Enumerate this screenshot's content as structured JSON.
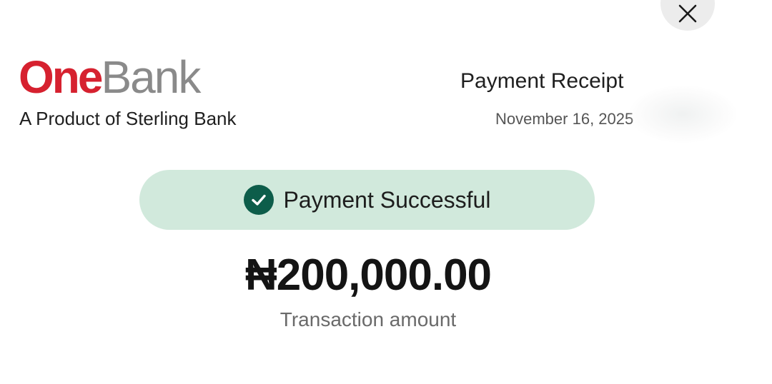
{
  "header": {
    "logo": {
      "part1": "One",
      "part2": "Bank"
    },
    "tagline": "A Product of Sterling Bank",
    "receipt_title": "Payment Receipt",
    "date": "November 16, 2025"
  },
  "status": {
    "label": "Payment Successful",
    "icon": "check-circle-icon",
    "color": "#0d5d4a",
    "background": "#d1e9dc"
  },
  "transaction": {
    "amount": "₦200,000.00",
    "amount_label": "Transaction amount"
  },
  "controls": {
    "close_icon": "close-icon"
  },
  "colors": {
    "brand_red": "#d6212f",
    "brand_gray": "#8a8a8a"
  }
}
